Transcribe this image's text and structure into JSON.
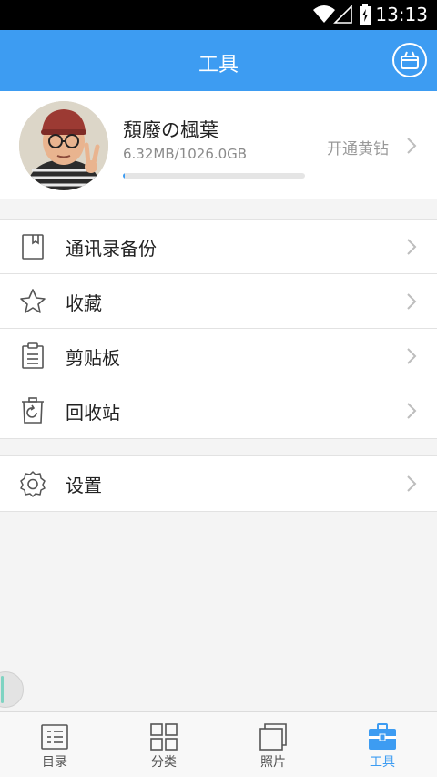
{
  "status_bar": {
    "time": "13:13"
  },
  "header": {
    "title": "工具",
    "action_icon": "gift-icon"
  },
  "profile": {
    "username": "頽廢の楓葉",
    "quota": "6.32MB/1026.0GB",
    "usage_fraction": 0.006,
    "vip_label": "开通黄钻"
  },
  "menu_groups": [
    [
      {
        "label": "通讯录备份",
        "icon": "contacts-book-icon"
      },
      {
        "label": "收藏",
        "icon": "star-icon"
      },
      {
        "label": "剪贴板",
        "icon": "clipboard-icon"
      },
      {
        "label": "回收站",
        "icon": "recycle-bin-icon"
      }
    ],
    [
      {
        "label": "设置",
        "icon": "gear-icon"
      }
    ]
  ],
  "bottom_nav": [
    {
      "label": "目录",
      "icon": "directory-icon",
      "active": false
    },
    {
      "label": "分类",
      "icon": "category-grid-icon",
      "active": false
    },
    {
      "label": "照片",
      "icon": "photos-icon",
      "active": false
    },
    {
      "label": "工具",
      "icon": "toolbox-icon",
      "active": true
    }
  ],
  "colors": {
    "accent": "#3d9cf2",
    "header_bg": "#3d9cf2",
    "background": "#f4f4f4"
  }
}
